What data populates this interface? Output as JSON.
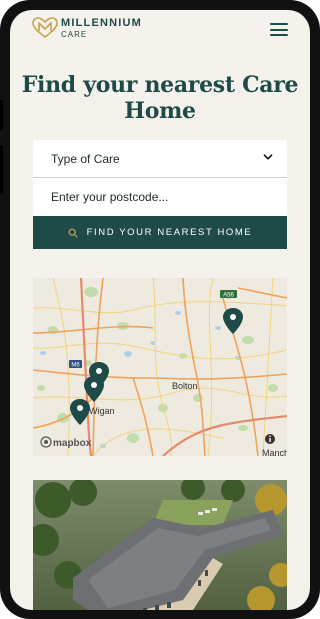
{
  "brand": {
    "name_line1": "MILLENNIUM",
    "name_line2": "CARE",
    "logo_icon": "heart-m-logo",
    "accent_color": "#c9a24b",
    "primary_color": "#1e4a48"
  },
  "menu": {
    "icon": "hamburger-menu-icon"
  },
  "hero": {
    "title": "Find your nearest Care Home"
  },
  "search": {
    "care_type_label": "Type of Care",
    "postcode_placeholder": "Enter your postcode...",
    "find_button_label": "FIND YOUR NEAREST HOME"
  },
  "map": {
    "labels": {
      "bolton": "Bolton",
      "wigan": "Wigan",
      "road_a56": "A56",
      "road_m6": "M6",
      "manchester_partial": "Mancheste"
    },
    "attribution": "mapbox",
    "marker_count": 4
  }
}
